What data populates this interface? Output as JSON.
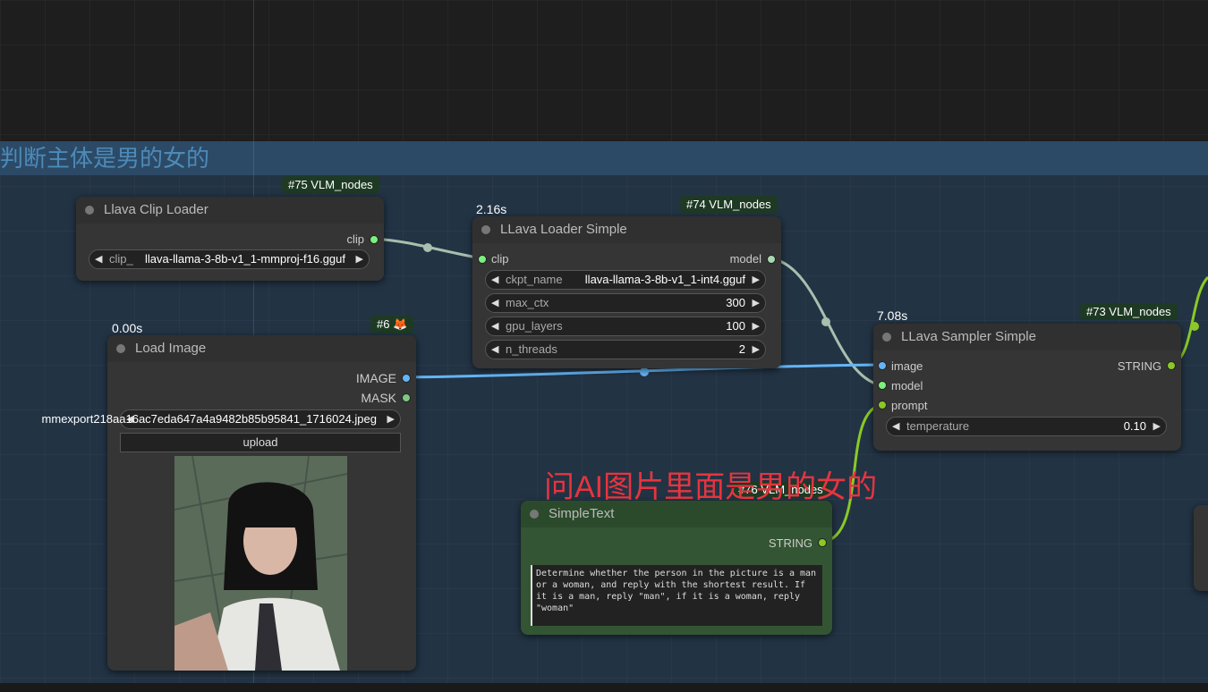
{
  "group": {
    "title": "判断主体是男的女的"
  },
  "annotation": "问AI图片里面是男的女的",
  "nodes": {
    "clip_loader": {
      "badge": "#75 VLM_nodes",
      "title": "Llava Clip Loader",
      "out_clip": "clip",
      "widget_label": "clip_",
      "widget_value": "llava-llama-3-8b-v1_1-mmproj-f16.gguf"
    },
    "loader_simple": {
      "time": "2.16s",
      "badge": "#74 VLM_nodes",
      "title": "LLava Loader Simple",
      "in_clip": "clip",
      "out_model": "model",
      "widgets": [
        {
          "label": "ckpt_name",
          "value": "llava-llama-3-8b-v1_1-int4.gguf"
        },
        {
          "label": "max_ctx",
          "value": "300"
        },
        {
          "label": "gpu_layers",
          "value": "100"
        },
        {
          "label": "n_threads",
          "value": "2"
        }
      ]
    },
    "load_image": {
      "time": "0.00s",
      "badge": "#6 🦊",
      "title": "Load Image",
      "out_image": "IMAGE",
      "out_mask": "MASK",
      "filename": "mmexport218aa16ac7eda647a4a9482b85b95841_1716024.jpeg",
      "upload_label": "upload"
    },
    "sampler": {
      "time": "7.08s",
      "badge": "#73 VLM_nodes",
      "title": "LLava Sampler Simple",
      "in_image": "image",
      "in_model": "model",
      "in_prompt": "prompt",
      "out_string": "STRING",
      "temperature_label": "temperature",
      "temperature_value": "0.10"
    },
    "simple_text": {
      "badge": "#76 VLM_nodes",
      "title": "SimpleText",
      "out_string": "STRING",
      "text": "Determine whether the person in the picture is a man or a woman, and reply with the shortest result. If it is a man, reply \"man\", if it is a woman, reply \"woman\""
    }
  },
  "colors": {
    "clip_link": "#a8bfae",
    "image_link": "#64b5f6",
    "string_link": "#8ac926",
    "annotation": "#e8343e"
  }
}
